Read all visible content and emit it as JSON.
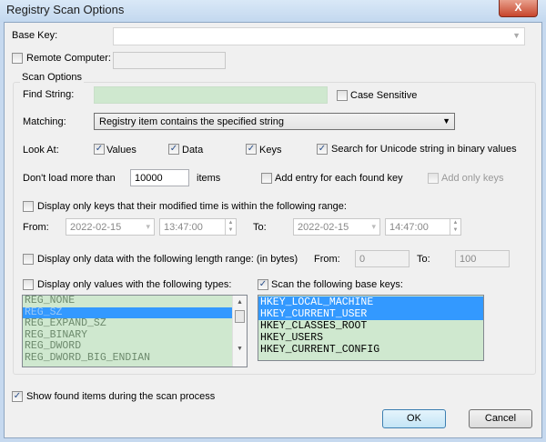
{
  "window": {
    "title": "Registry Scan Options",
    "close_glyph": "X"
  },
  "base_key": {
    "label": "Base Key:",
    "value": ""
  },
  "remote": {
    "label": "Remote Computer:",
    "checked": false,
    "value": ""
  },
  "scan_options": {
    "group_label": "Scan Options",
    "find_string": {
      "label": "Find String:",
      "value": ""
    },
    "case_sensitive": {
      "label": "Case Sensitive",
      "checked": false
    },
    "matching": {
      "label": "Matching:",
      "value": "Registry item contains the specified string"
    },
    "look_at": {
      "label": "Look At:",
      "values": "Values",
      "data": "Data",
      "keys": "Keys",
      "unicode": "Search for Unicode string in binary values"
    },
    "limit": {
      "label": "Don't load more than",
      "value": "10000",
      "unit": "items"
    },
    "add_entry": {
      "label": "Add entry for each found key",
      "checked": false
    },
    "add_only_keys": {
      "label": "Add only keys",
      "checked": false
    },
    "modified": {
      "label": "Display only keys that their modified time is within the following range:",
      "checked": false,
      "from_label": "From:",
      "from_date": "2022-02-15",
      "from_time": "13:47:00",
      "to_label": "To:",
      "to_date": "2022-02-15",
      "to_time": "14:47:00"
    },
    "length": {
      "label": "Display only data with the following length range: (in bytes)",
      "checked": false,
      "from_label": "From:",
      "from": "0",
      "to_label": "To:",
      "to": "100"
    },
    "types": {
      "label": "Display only values with the following types:",
      "checked": false,
      "items": [
        "REG_NONE",
        "REG_SZ",
        "REG_EXPAND_SZ",
        "REG_BINARY",
        "REG_DWORD",
        "REG_DWORD_BIG_ENDIAN"
      ],
      "selected": "REG_SZ"
    },
    "base_keys": {
      "label": "Scan the following base keys:",
      "checked": true,
      "items": [
        "HKEY_LOCAL_MACHINE",
        "HKEY_CURRENT_USER",
        "HKEY_CLASSES_ROOT",
        "HKEY_USERS",
        "HKEY_CURRENT_CONFIG"
      ],
      "selected": [
        "HKEY_LOCAL_MACHINE",
        "HKEY_CURRENT_USER"
      ]
    }
  },
  "show_found": {
    "label": "Show found items during the scan process",
    "checked": true
  },
  "buttons": {
    "ok": "OK",
    "cancel": "Cancel"
  }
}
